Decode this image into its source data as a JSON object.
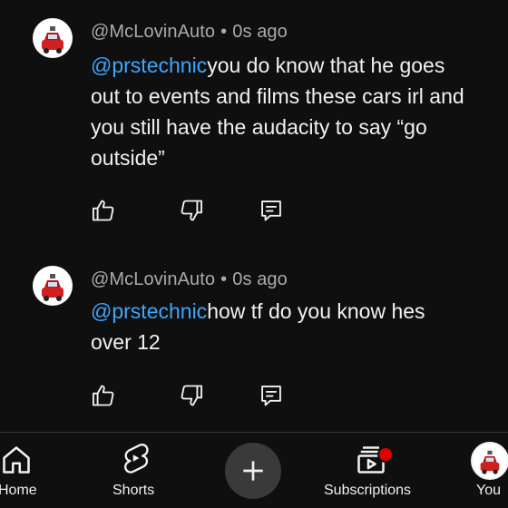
{
  "comments": [
    {
      "author": "@McLovinAuto",
      "separator": "•",
      "time": "0s ago",
      "mention": "@prstechnic",
      "body_line1": "you do know that he goes",
      "body_line2": "out to events and films these cars irl and",
      "body_line3": "you still have the audacity to say “go",
      "body_line4": "outside”"
    },
    {
      "author": "@McLovinAuto",
      "separator": "•",
      "time": "0s ago",
      "mention": "@prstechnic",
      "body_line1": "how tf do you know hes",
      "body_line2": "over 12"
    }
  ],
  "bottom_nav": {
    "home_label": "Home",
    "shorts_label": "Shorts",
    "create_icon": "plus-icon",
    "subscriptions_label": "Subscriptions",
    "you_label": "You"
  },
  "colors": {
    "background": "#0f0f0f",
    "mention": "#3ea6ff",
    "meta_text": "#aaaaaa",
    "notification": "#e00000"
  }
}
